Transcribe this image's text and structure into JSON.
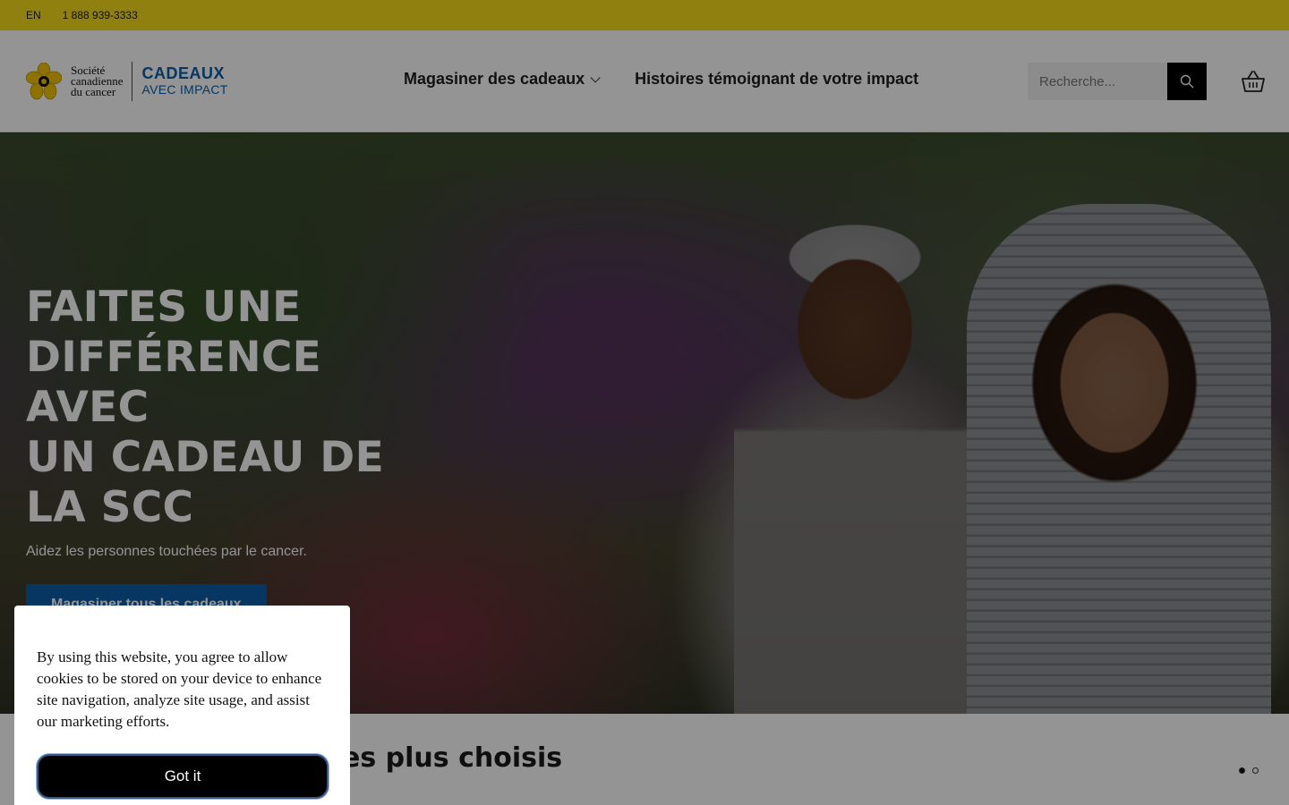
{
  "topbar": {
    "language": "EN",
    "phone": "1 888 939-3333"
  },
  "logo": {
    "org_line1": "Société",
    "org_line2": "canadienne",
    "org_line3": "du cancer",
    "brand_line1": "CADEAUX",
    "brand_line2": "AVEC IMPACT"
  },
  "nav": {
    "shop_label": "Magasiner des cadeaux",
    "stories_label": "Histoires témoignant de votre impact"
  },
  "search": {
    "placeholder": "Recherche..."
  },
  "hero": {
    "title_line1": "FAITES UNE",
    "title_line2": "DIFFÉRENCE AVEC",
    "title_line3": "UN CADEAU DE",
    "title_line4": "LA SCC",
    "subtitle": "Aidez les personnes touchées par le cancer.",
    "cta_label": "Magasiner tous les cadeaux"
  },
  "section": {
    "title_visible": "es plus choisis"
  },
  "carousel": {
    "pages": 2,
    "active_index": 0
  },
  "cookie": {
    "message": "By using this website, you agree to allow cookies to be stored on your device to enhance site navigation, analyze site usage, and assist our marketing efforts.",
    "button_label": "Got it"
  },
  "colors": {
    "topbar_bg": "#f9dc1c",
    "brand_blue": "#0b5ea8",
    "search_button": "#000000",
    "cookie_button": "#000000"
  },
  "icons": {
    "search": "search-icon",
    "cart": "shopping-basket-icon",
    "logo": "daffodil-icon",
    "dropdown": "chevron-down-icon"
  }
}
